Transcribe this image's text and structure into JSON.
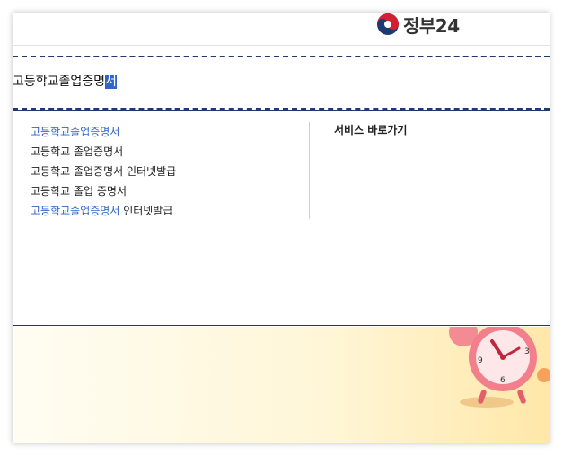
{
  "header": {
    "logo_text": "정부24"
  },
  "search": {
    "value_prefix": "고등학교졸업증명",
    "value_selected": "서"
  },
  "suggestions": [
    {
      "highlight": "고등학교졸업증명서",
      "rest": ""
    },
    {
      "highlight": "",
      "rest": "고등학교 졸업증명서"
    },
    {
      "highlight": "",
      "rest": "고등학교 졸업증명서 인터넷발급"
    },
    {
      "highlight": "",
      "rest": "고등학교 졸업 증명서"
    },
    {
      "highlight": "고등학교졸업증명서",
      "rest": " 인터넷발급"
    }
  ],
  "service": {
    "title": "서비스 바로가기"
  },
  "colors": {
    "accent": "#2f66c7",
    "navy": "#1e3a6e",
    "banner_bg": "#fff6d6"
  }
}
